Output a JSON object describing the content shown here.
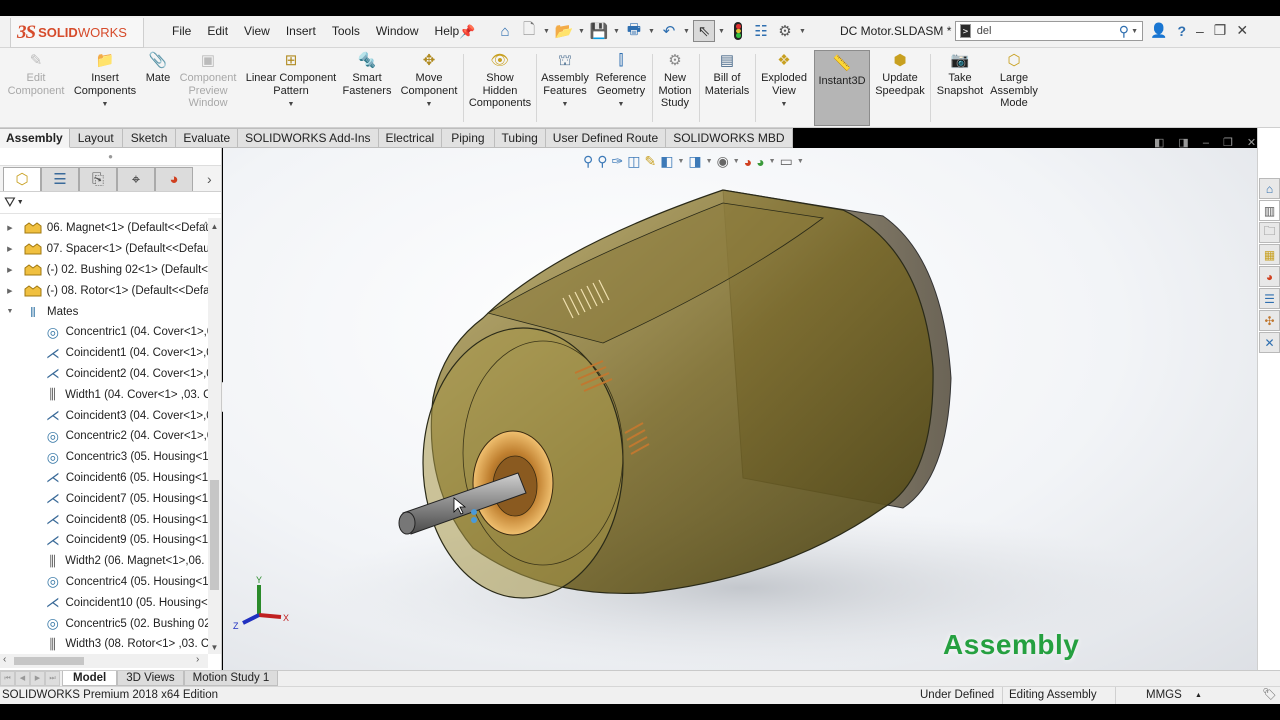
{
  "app": {
    "brand": {
      "ds": "3S",
      "solid": "SOLID",
      "works": "WORKS"
    },
    "menu": [
      "File",
      "Edit",
      "View",
      "Insert",
      "Tools",
      "Window",
      "Help"
    ],
    "document_title": "DC Motor.SLDASM *",
    "search": {
      "value": "del",
      "prefix_icon": "command-prompt-icon"
    },
    "quick_access": [
      "home-icon",
      "new-document-icon",
      "open-icon",
      "save-icon",
      "print-icon",
      "undo-icon",
      "select-icon",
      "rebuild-icon",
      "file-properties-icon",
      "options-icon"
    ]
  },
  "ribbon": {
    "buttons": [
      {
        "id": "edit-component",
        "label_lines": [
          "Edit",
          "Component"
        ],
        "disabled": true,
        "has_arrow": false,
        "icon": "edit-component-icon"
      },
      {
        "id": "insert-components",
        "label_lines": [
          "Insert",
          "Components"
        ],
        "disabled": false,
        "has_arrow": true,
        "icon": "insert-components-icon"
      },
      {
        "id": "mate",
        "label_lines": [
          "Mate"
        ],
        "disabled": false,
        "has_arrow": false,
        "icon": "paperclip-icon"
      },
      {
        "id": "component-preview-window",
        "label_lines": [
          "Component",
          "Preview",
          "Window"
        ],
        "disabled": true,
        "has_arrow": false,
        "icon": "preview-window-icon"
      },
      {
        "id": "linear-component-pattern",
        "label_lines": [
          "Linear Component",
          "Pattern"
        ],
        "disabled": false,
        "has_arrow": true,
        "icon": "pattern-icon"
      },
      {
        "id": "smart-fasteners",
        "label_lines": [
          "Smart",
          "Fasteners"
        ],
        "disabled": false,
        "has_arrow": false,
        "icon": "fasteners-icon"
      },
      {
        "id": "move-component",
        "label_lines": [
          "Move",
          "Component"
        ],
        "disabled": false,
        "has_arrow": true,
        "icon": "move-component-icon"
      },
      {
        "id": "show-hidden-components",
        "label_lines": [
          "Show",
          "Hidden",
          "Components"
        ],
        "disabled": false,
        "has_arrow": false,
        "icon": "show-hidden-icon"
      },
      {
        "id": "assembly-features",
        "label_lines": [
          "Assembly",
          "Features"
        ],
        "disabled": false,
        "has_arrow": true,
        "icon": "assembly-features-icon"
      },
      {
        "id": "reference-geometry",
        "label_lines": [
          "Reference",
          "Geometry"
        ],
        "disabled": false,
        "has_arrow": true,
        "icon": "reference-geometry-icon"
      },
      {
        "id": "new-motion-study",
        "label_lines": [
          "New",
          "Motion",
          "Study"
        ],
        "disabled": false,
        "has_arrow": false,
        "icon": "motion-study-icon"
      },
      {
        "id": "bill-of-materials",
        "label_lines": [
          "Bill of",
          "Materials"
        ],
        "disabled": false,
        "has_arrow": false,
        "icon": "bom-icon"
      },
      {
        "id": "exploded-view",
        "label_lines": [
          "Exploded",
          "View"
        ],
        "disabled": false,
        "has_arrow": true,
        "icon": "exploded-view-icon"
      },
      {
        "id": "instant3d",
        "label_lines": [
          "Instant3D"
        ],
        "disabled": false,
        "has_arrow": false,
        "active": true,
        "icon": "instant3d-icon"
      },
      {
        "id": "update-speedpak",
        "label_lines": [
          "Update",
          "Speedpak"
        ],
        "disabled": false,
        "has_arrow": false,
        "icon": "speedpak-icon"
      },
      {
        "id": "take-snapshot",
        "label_lines": [
          "Take",
          "Snapshot"
        ],
        "disabled": false,
        "has_arrow": false,
        "icon": "camera-icon"
      },
      {
        "id": "large-assembly-mode",
        "label_lines": [
          "Large",
          "Assembly",
          "Mode"
        ],
        "disabled": false,
        "has_arrow": false,
        "icon": "large-assembly-icon"
      }
    ]
  },
  "command_tabs": [
    {
      "label": "Assembly",
      "active": true
    },
    {
      "label": "Layout"
    },
    {
      "label": "Sketch"
    },
    {
      "label": "Evaluate"
    },
    {
      "label": "SOLIDWORKS Add-Ins"
    },
    {
      "label": "Electrical"
    },
    {
      "label": "Piping"
    },
    {
      "label": "Tubing"
    },
    {
      "label": "User Defined Route"
    },
    {
      "label": "SOLIDWORKS MBD"
    }
  ],
  "feature_manager": {
    "tabs": [
      "featuremanager-tree-icon",
      "propertymanager-icon",
      "configurationmanager-icon",
      "dimxpert-icon",
      "display-manager-icon"
    ],
    "components": [
      {
        "label": "06. Magnet<1> (Default<<Defau"
      },
      {
        "label": "07. Spacer<1> (Default<<Default"
      },
      {
        "label": "(-) 02. Bushing 02<1> (Default<<"
      },
      {
        "label": "(-) 08. Rotor<1> (Default<<Defau"
      }
    ],
    "mates_folder": "Mates",
    "mates": [
      {
        "type": "concentric",
        "label": "Concentric1 (04. Cover<1>,0"
      },
      {
        "type": "coincident",
        "label": "Coincident1 (04. Cover<1>,0"
      },
      {
        "type": "coincident",
        "label": "Coincident2 (04. Cover<1>,0"
      },
      {
        "type": "width",
        "label": "Width1 (04. Cover<1> ,03. Co"
      },
      {
        "type": "coincident",
        "label": "Coincident3 (04. Cover<1>,0"
      },
      {
        "type": "concentric",
        "label": "Concentric2 (04. Cover<1>,0"
      },
      {
        "type": "concentric",
        "label": "Concentric3 (05. Housing<1:"
      },
      {
        "type": "coincident",
        "label": "Coincident6 (05. Housing<1:"
      },
      {
        "type": "coincident",
        "label": "Coincident7 (05. Housing<1:"
      },
      {
        "type": "coincident",
        "label": "Coincident8 (05. Housing<1:"
      },
      {
        "type": "coincident",
        "label": "Coincident9 (05. Housing<1:"
      },
      {
        "type": "width",
        "label": "Width2 (06. Magnet<1>,06. M"
      },
      {
        "type": "concentric",
        "label": "Concentric4 (05. Housing<1:"
      },
      {
        "type": "coincident",
        "label": "Coincident10 (05. Housing<1"
      },
      {
        "type": "concentric",
        "label": "Concentric5 (02. Bushing 02-"
      },
      {
        "type": "width",
        "label": "Width3 (08. Rotor<1> ,03. Co"
      }
    ]
  },
  "viewport": {
    "heads_up_toolbar": [
      "zoom-to-fit-icon",
      "zoom-to-area-icon",
      "previous-view-icon",
      "section-view-icon",
      "dynamic-annotation-icon",
      "view-orientation-icon",
      "display-style-icon",
      "hide-show-icon",
      "edit-appearance-icon",
      "apply-scene-icon",
      "view-settings-icon"
    ],
    "triad": {
      "x": "X",
      "y": "Y",
      "z": "Z"
    },
    "watermark": "Assembly",
    "model": "DC Motor assembly (transparent housing)"
  },
  "task_pane": [
    "solidworks-resources-icon",
    "design-library-icon",
    "file-explorer-icon",
    "view-palette-icon",
    "appearances-icon",
    "custom-properties-icon",
    "solidworks-forum-icon",
    "3dexperience-icon"
  ],
  "bottom_tabs": [
    {
      "label": "Model",
      "active": true
    },
    {
      "label": "3D Views"
    },
    {
      "label": "Motion Study 1"
    }
  ],
  "status_bar": {
    "edition": "SOLIDWORKS Premium 2018 x64 Edition",
    "definition": "Under Defined",
    "mode": "Editing Assembly",
    "units": "MMGS"
  },
  "colors": {
    "brand_red": "#d64b2b",
    "watermark_green": "#25a040",
    "accent_blue": "#2f6fb0",
    "housing_olive": "#7a6a2a"
  }
}
